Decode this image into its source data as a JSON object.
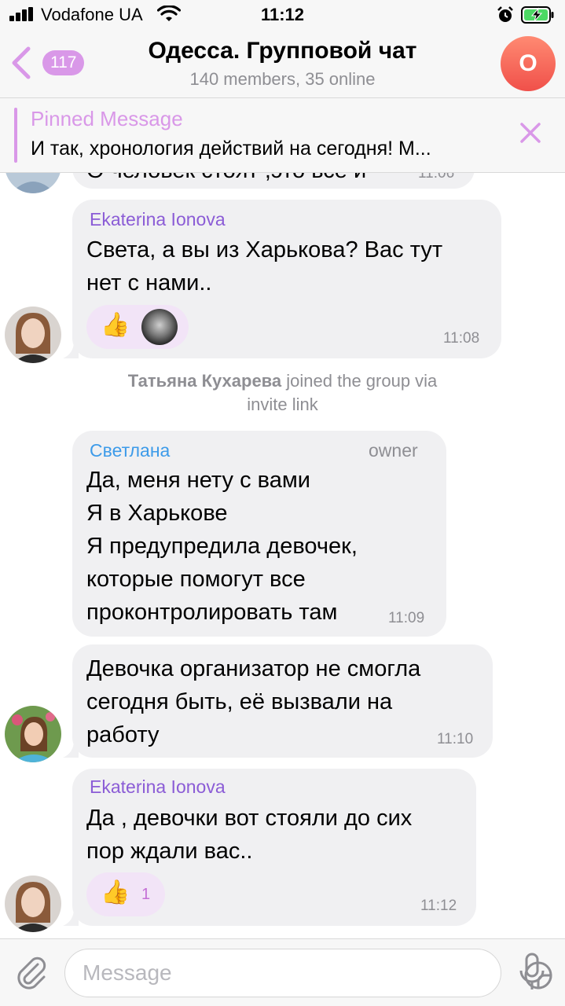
{
  "status_bar": {
    "carrier": "Vodafone UA",
    "time": "11:12",
    "icons": [
      "signal-icon",
      "wifi-icon",
      "alarm-icon",
      "battery-charging-icon"
    ]
  },
  "nav": {
    "back_badge": "117",
    "title": "Одесса. Групповой чат",
    "subtitle": "140 members, 35 online",
    "avatar_letter": "О",
    "avatar_color": "#f0504a"
  },
  "pinned": {
    "title": "Pinned Message",
    "text": "И так, хронология действий на сегодня! М..."
  },
  "messages": [
    {
      "partial_text": "О человек стоят ,это все и",
      "time": "11:06"
    },
    {
      "sender": "Ekaterina Ionova",
      "sender_color": "#8b5cd6",
      "lines": [
        "Света, а вы из Харькова? Вас тут",
        "нет с нами.."
      ],
      "reaction": "👍",
      "time": "11:08"
    },
    {
      "system": true,
      "actor": "Татьяна Кухарева",
      "text": " joined the group via",
      "text2": "invite link"
    },
    {
      "sender": "Светлана",
      "sender_color": "#3d9be9",
      "role": "owner",
      "lines": [
        "Да, меня нету с вами",
        "Я в Харькове",
        "Я предупредила девочек,",
        "которые помогут все",
        "проконтролировать там"
      ],
      "time": "11:09"
    },
    {
      "lines": [
        "Девочка организатор не смогла",
        "сегодня быть, её вызвали на",
        "работу"
      ],
      "time": "11:10"
    },
    {
      "sender": "Ekaterina Ionova",
      "sender_color": "#8b5cd6",
      "lines": [
        "Да , девочки вот стояли до сих",
        "пор ждали вас.."
      ],
      "reaction": "👍",
      "reaction_count": "1",
      "time": "11:12"
    }
  ],
  "input": {
    "placeholder": "Message"
  },
  "colors": {
    "accent": "#d998e8",
    "bubble": "#f0f0f2",
    "reaction_bg": "#f2e4f7"
  }
}
